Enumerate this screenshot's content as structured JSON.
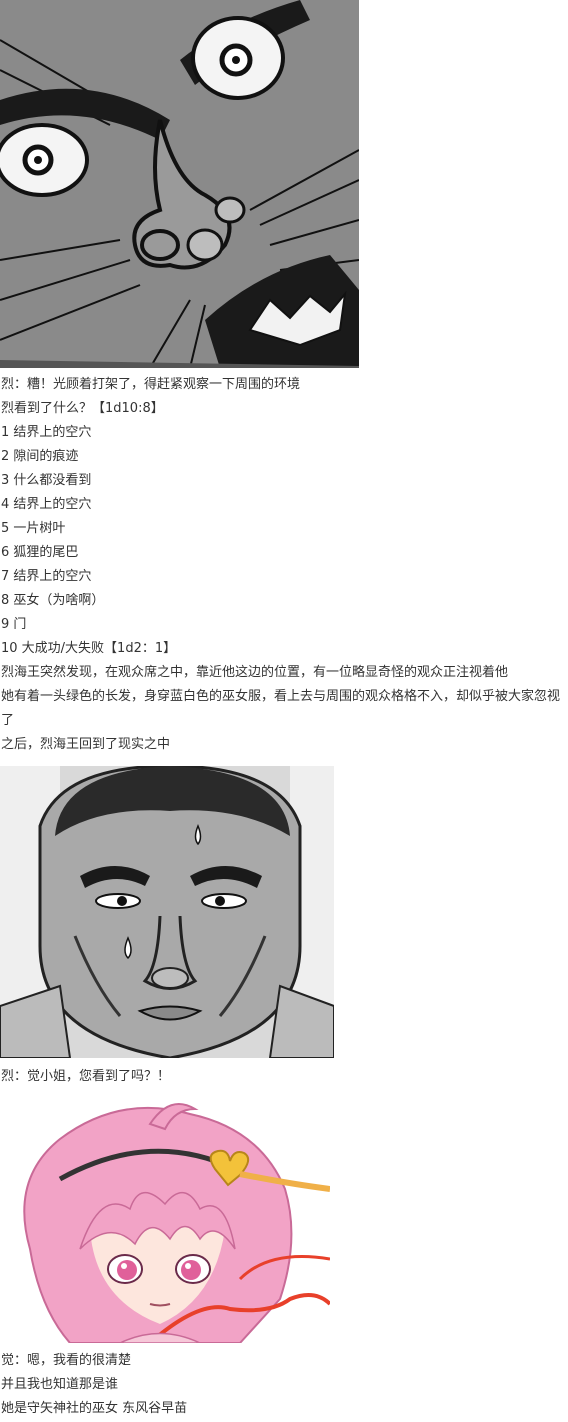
{
  "text": {
    "line1": "烈：糟！光顾着打架了，得赶紧观察一下周围的环境",
    "line2": "烈看到了什么？【1d10:8】",
    "options": [
      "1 结界上的空穴",
      "2 隙间的痕迹",
      "3 什么都没看到",
      "4 结界上的空穴",
      "5 一片树叶",
      "6 狐狸的尾巴",
      "7 结界上的空穴",
      "8 巫女（为啥啊）",
      "9 门",
      "10 大成功/大失败【1d2：1】"
    ],
    "line13": "烈海王突然发现，在观众席之中，靠近他这边的位置，有一位略显奇怪的观众正注视着他",
    "line14": "她有着一头绿色的长发，身穿蓝白色的巫女服，看上去与周围的观众格格不入，却似乎被大家忽视了",
    "line15": "之后，烈海王回到了现实之中",
    "line16": "烈：觉小姐，您看到了吗？！",
    "line17": "觉：嗯，我看的很清楚",
    "line18": "并且我也知道那是谁",
    "line19": "她是守矢神社的巫女 东风谷早苗"
  },
  "colors": {
    "text": "#333333",
    "background": "#ffffff",
    "hair_pink": "#f2a3c6",
    "eye_pink": "#e0609a",
    "ribbon_red": "#e8402a"
  },
  "icons": [
    "manga-shocked-face-image",
    "manga-sweating-face-image",
    "anime-pink-hair-girl-image"
  ]
}
